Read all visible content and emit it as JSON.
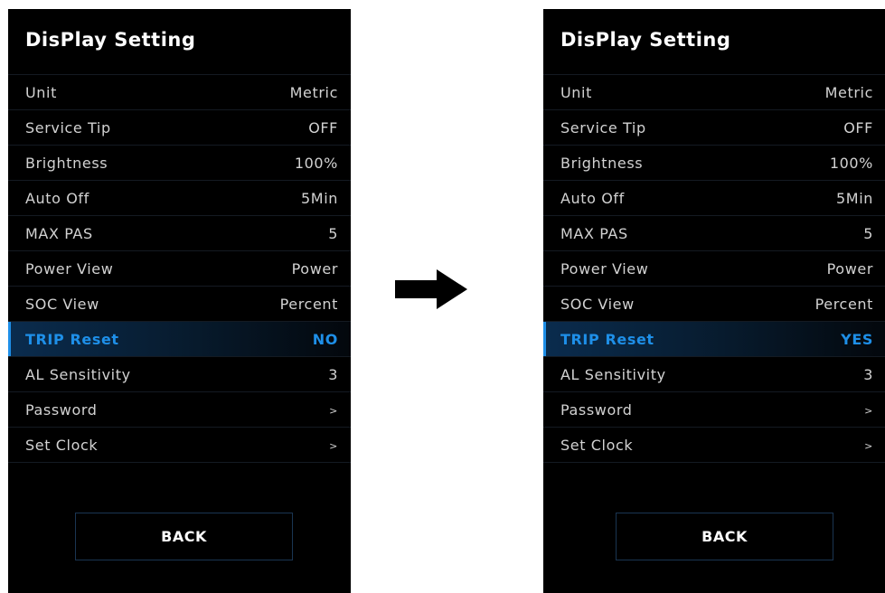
{
  "screens": [
    {
      "title": "DisPlay Setting",
      "rows": [
        {
          "label": "Unit",
          "value": "Metric"
        },
        {
          "label": "Service Tip",
          "value": "OFF"
        },
        {
          "label": "Brightness",
          "value": "100%"
        },
        {
          "label": "Auto Off",
          "value": "5Min"
        },
        {
          "label": "MAX PAS",
          "value": "5"
        },
        {
          "label": "Power View",
          "value": "Power"
        },
        {
          "label": "SOC View",
          "value": "Percent"
        },
        {
          "label": "TRIP Reset",
          "value": "NO"
        },
        {
          "label": "AL Sensitivity",
          "value": "3"
        },
        {
          "label": "Password",
          "value": ">"
        },
        {
          "label": "Set Clock",
          "value": ">"
        }
      ],
      "back_label": "BACK"
    },
    {
      "title": "DisPlay Setting",
      "rows": [
        {
          "label": "Unit",
          "value": "Metric"
        },
        {
          "label": "Service Tip",
          "value": "OFF"
        },
        {
          "label": "Brightness",
          "value": "100%"
        },
        {
          "label": "Auto Off",
          "value": "5Min"
        },
        {
          "label": "MAX PAS",
          "value": "5"
        },
        {
          "label": "Power View",
          "value": "Power"
        },
        {
          "label": "SOC View",
          "value": "Percent"
        },
        {
          "label": "TRIP Reset",
          "value": "YES"
        },
        {
          "label": "AL Sensitivity",
          "value": "3"
        },
        {
          "label": "Password",
          "value": ">"
        },
        {
          "label": "Set Clock",
          "value": ">"
        }
      ],
      "back_label": "BACK"
    }
  ],
  "selected_row_label": "TRIP Reset",
  "transition_icon": "right-arrow-icon",
  "colors": {
    "accent": "#1e8fe8",
    "screen_background": "#000000",
    "page_background": "#ffffff",
    "text": "#d2d2d2"
  }
}
